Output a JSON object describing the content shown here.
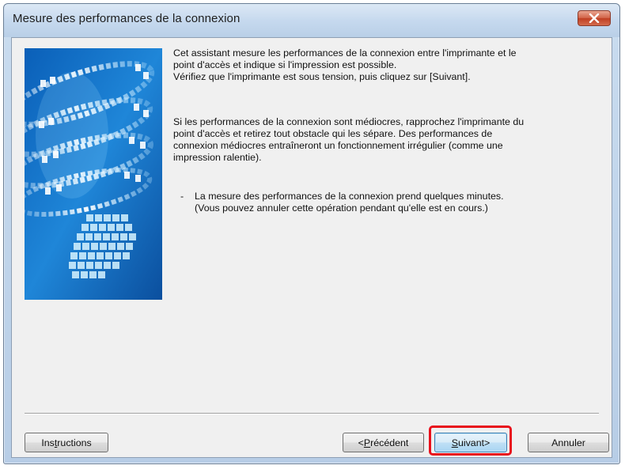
{
  "window": {
    "title": "Mesure des performances de la connexion"
  },
  "content": {
    "paragraph1": "Cet assistant mesure les performances de la connexion entre l'imprimante et le\npoint d'accès et indique si l'impression est possible.\nVérifiez que l'imprimante est sous tension, puis cliquez sur [Suivant].",
    "paragraph2": "Si les performances de la connexion sont médiocres, rapprochez l'imprimante du\npoint d'accès et retirez tout obstacle qui les sépare. Des performances de\nconnexion médiocres entraîneront un fonctionnement irrégulier (comme une\nimpression ralentie).",
    "bullet_marker": "-",
    "bullet_text": "La mesure des performances de la connexion prend quelques minutes.\n(Vous pouvez annuler cette opération pendant qu'elle est en cours.)"
  },
  "buttons": {
    "instructions": {
      "pre": "Ins",
      "accel": "t",
      "post": "ructions"
    },
    "previous": {
      "pre": "<",
      "accel": "P",
      "post": "récédent"
    },
    "next": {
      "pre": "",
      "accel": "S",
      "post": "uivant>"
    },
    "cancel": "Annuler"
  },
  "icons": {
    "close": "close-icon",
    "banner": "printer-banner-image"
  },
  "colors": {
    "highlight_ring": "#e8101c",
    "close_button": "#c84a2e",
    "banner_blue": "#1f7fd0"
  }
}
